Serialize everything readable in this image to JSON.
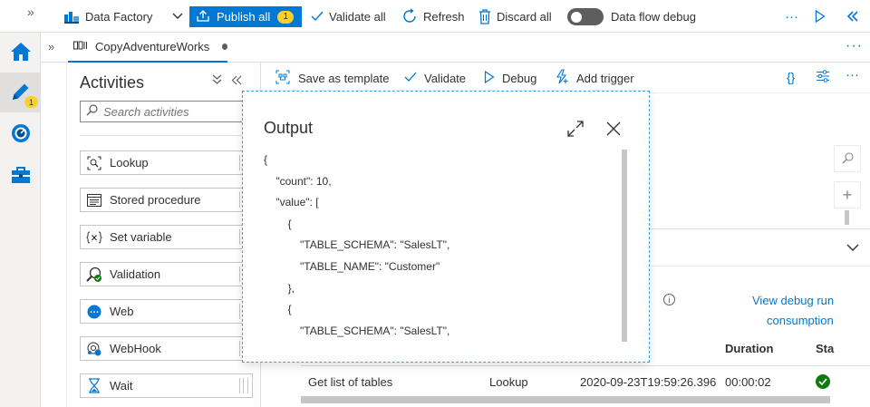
{
  "topbar": {
    "collapse": "»",
    "factory_label": "Data Factory",
    "publish_label": "Publish all",
    "publish_count": "1",
    "validate_label": "Validate all",
    "refresh_label": "Refresh",
    "discard_label": "Discard all",
    "debug_label": "Data flow debug",
    "more": "···"
  },
  "rail": {
    "author_badge": "1"
  },
  "tab": {
    "collapse": "»",
    "name": "CopyAdventureWorks",
    "more": "···"
  },
  "activities": {
    "title": "Activities",
    "search_placeholder": "Search activities",
    "items": [
      {
        "label": "Lookup",
        "icon": "lookup-icon"
      },
      {
        "label": "Stored procedure",
        "icon": "stored-procedure-icon"
      },
      {
        "label": "Set variable",
        "icon": "set-variable-icon"
      },
      {
        "label": "Validation",
        "icon": "validation-icon"
      },
      {
        "label": "Web",
        "icon": "web-icon"
      },
      {
        "label": "WebHook",
        "icon": "webhook-icon"
      },
      {
        "label": "Wait",
        "icon": "wait-icon"
      }
    ]
  },
  "canvas": {
    "save_template": "Save as template",
    "validate": "Validate",
    "debug": "Debug",
    "add_trigger": "Add trigger",
    "json_glyph": "{}",
    "more": "···",
    "zoom_in": "+"
  },
  "output_pane": {
    "view_debug_line1": "View debug run",
    "view_debug_line2": "consumption",
    "columns": {
      "duration": "Duration",
      "status": "Sta"
    },
    "row": {
      "name": "Get list of tables",
      "type": "Lookup",
      "start": "2020-09-23T19:59:26.396",
      "duration": "00:00:02"
    }
  },
  "dialog": {
    "title": "Output",
    "content": "{\n    \"count\": 10,\n    \"value\": [\n        {\n            \"TABLE_SCHEMA\": \"SalesLT\",\n            \"TABLE_NAME\": \"Customer\"\n        },\n        {\n            \"TABLE_SCHEMA\": \"SalesLT\",\n            \"TABLE_NAME\": \"ProductModel\"\n        },\n        {"
  },
  "colors": {
    "accent": "#0078d4",
    "badge": "#f8d22a",
    "success": "#107c10"
  }
}
